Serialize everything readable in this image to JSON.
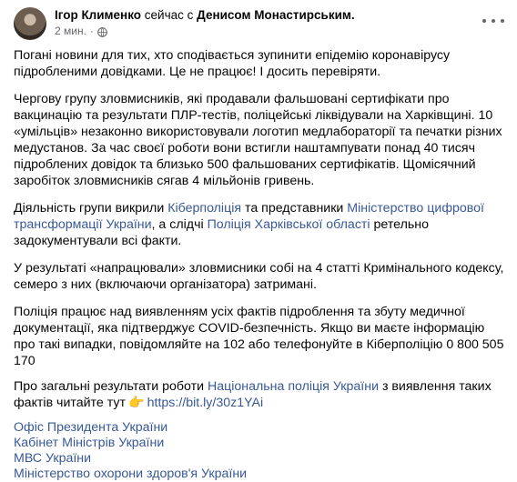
{
  "header": {
    "author": "Ігор Клименко",
    "with_text": "сейчас с",
    "tagged": "Денисом Монастирським.",
    "time": "2 мин.",
    "separator": "·"
  },
  "post": {
    "p1": "Погані новини для тих, хто сподівається зупинити епідемію коронавірусу підробленими довідками. Це не працює! І досить перевіряти.",
    "p2": "Чергову групу зловмисників, які продавали фальшовані сертифікати про вакцинацію та результати ПЛР-тестів, поліцейські ліквідували на Харківщині. 10 «умільців» незаконно використовували логотип медлабораторії та печатки різних медустанов. За час своєї роботи вони встигли наштампувати понад 40 тисяч підроблених довідок та близько 500 фальшованих сертифікатів. Щомісячний заробіток зловмисників сягав 4 мільйонів гривень.",
    "p3_a": "Діяльність групи викрили ",
    "p3_link1": "Кіберполіція",
    "p3_b": " та представники ",
    "p3_link2": "Міністерство цифрової трансформації України",
    "p3_c": ", а слідчі ",
    "p3_link3": "Поліція Харківської області",
    "p3_d": " ретельно задокументували всі факти.",
    "p4": "У результаті «напрацювали» зловмисники собі на 4 статті Кримінального кодексу, семеро з них (включаючи організатора) затримані.",
    "p5": "Поліція працює над виявленням усіх фактів підроблення та збуту медичної документації, яка підтверджує COVID-безпечність. Якщо ви маєте інформацію про такі випадки, повідомляйте на 102 або телефонуйте в Кіберполіцію 0 800 505 170",
    "p6_a": "Про загальні результати роботи ",
    "p6_link": "Національна поліція України",
    "p6_b": " з виявлення таких фактів читайте тут",
    "p6_emoji": "👉",
    "p6_url": "https://bit.ly/30z1YAi",
    "tags": [
      "Офіс Президента України",
      "Кабінет Міністрів України",
      "МВС України",
      "Міністерство охорони здоров'я України"
    ]
  },
  "colors": {
    "link": "#385898",
    "secondary": "#65676b",
    "text": "#050505"
  },
  "icons": {
    "privacy": "globe-icon",
    "menu": "more-options-icon"
  }
}
